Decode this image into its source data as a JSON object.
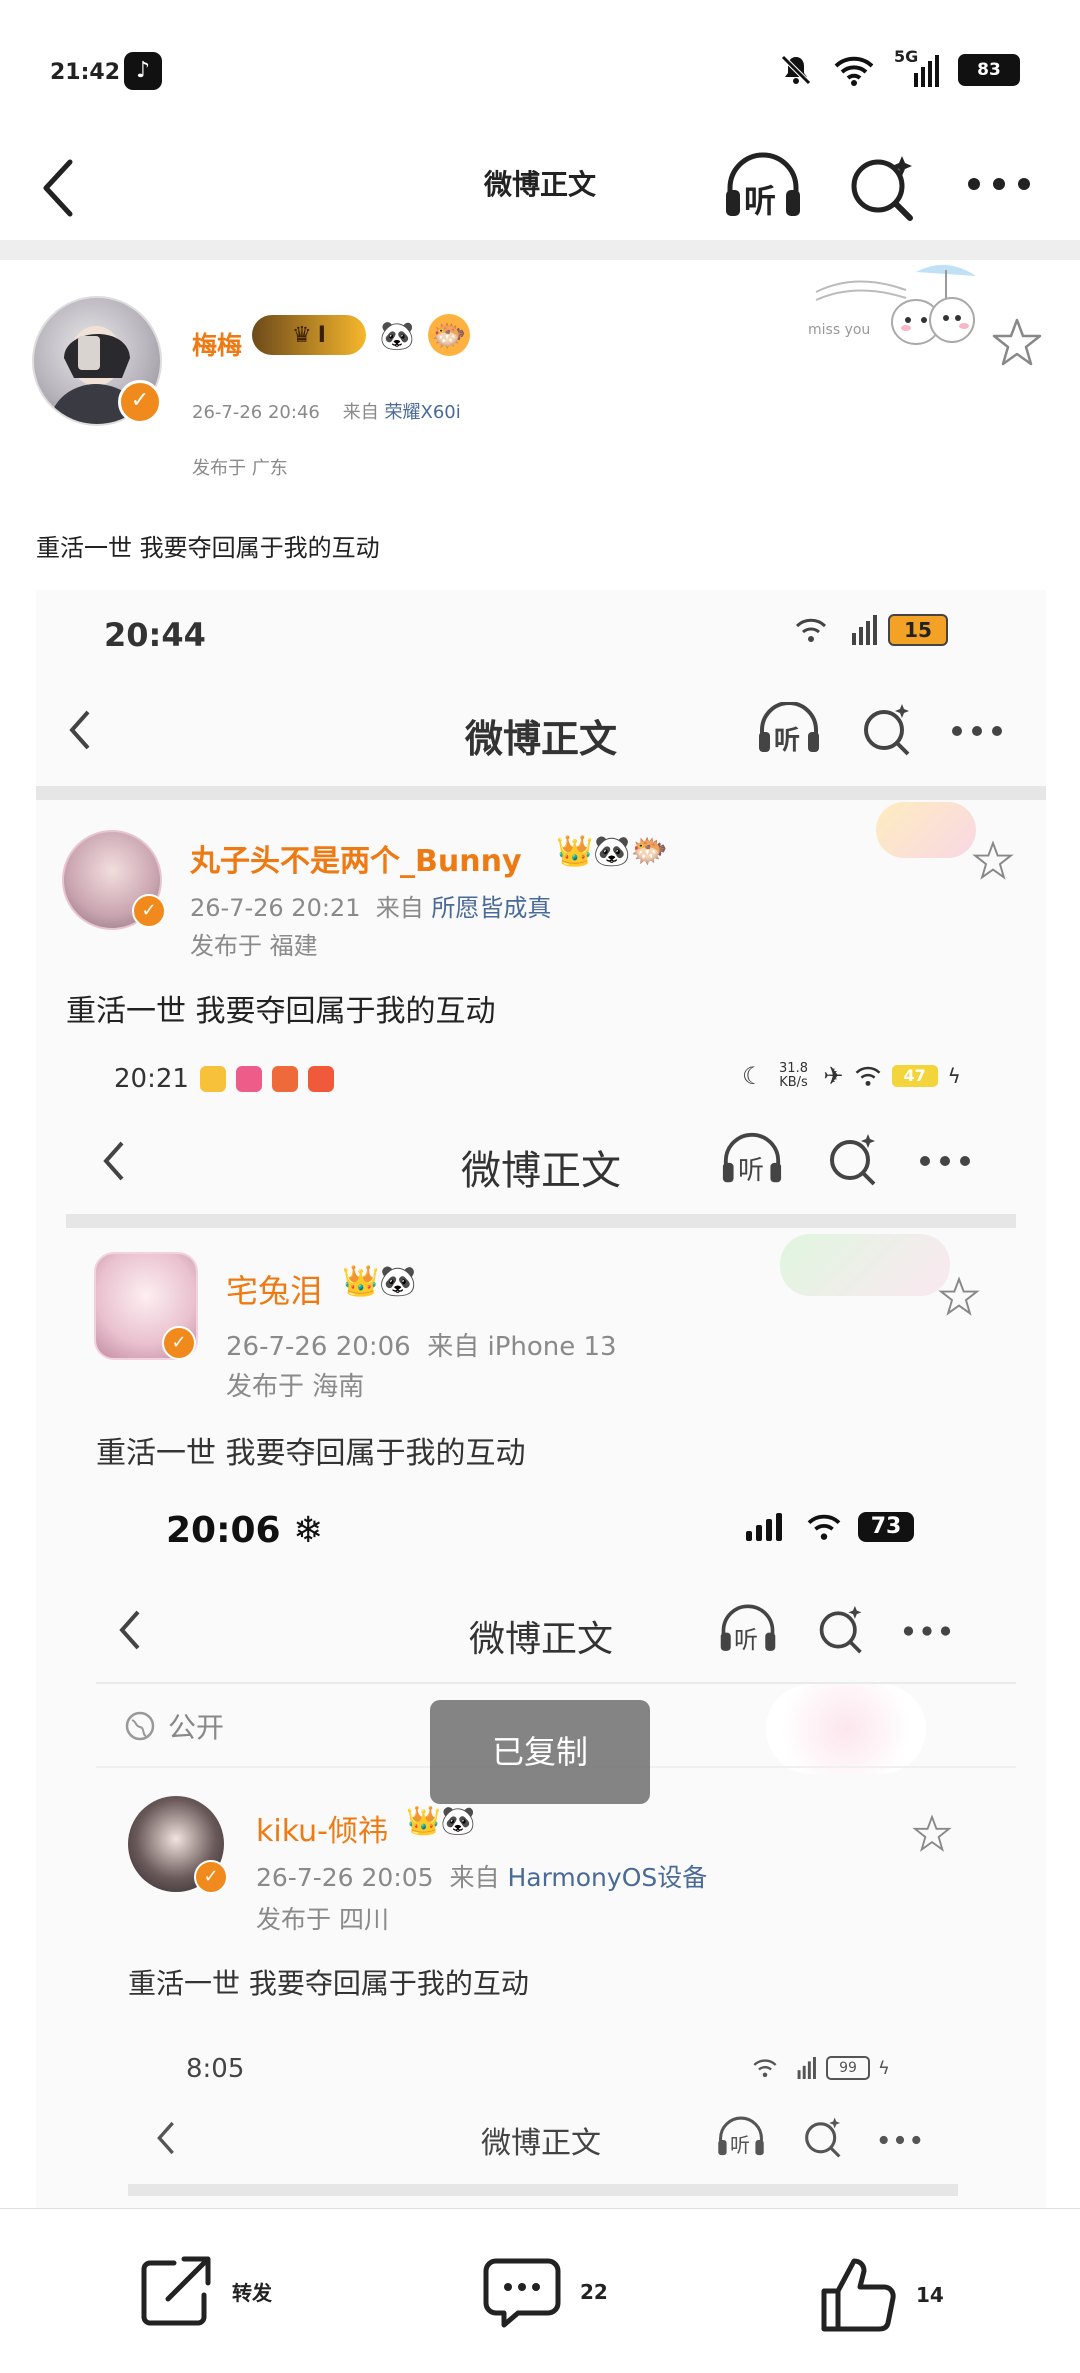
{
  "status_bar": {
    "time": "21:42",
    "network": "5G",
    "battery": "83"
  },
  "nav": {
    "title": "微博正文",
    "listen_label": "听"
  },
  "post": {
    "username": "梅梅",
    "badge_text": "I",
    "timestamp": "26-7-26 20:46",
    "from_prefix": "来自",
    "source": "荣耀X60i",
    "location": "发布于 广东",
    "deco_text": "miss you",
    "text": "重活一世 我要夺回属于我的互动"
  },
  "embed": {
    "level1": {
      "time": "20:44",
      "battery": "15",
      "nav_title": "微博正文",
      "listen_label": "听",
      "username": "丸子头不是两个_Bunny",
      "timestamp": "26-7-26 20:21",
      "from_prefix": "来自",
      "source": "所愿皆成真",
      "location": "发布于 福建",
      "text": "重活一世 我要夺回属于我的互动"
    },
    "level2": {
      "time": "20:21",
      "speed": "31.8 KB/s",
      "battery": "47",
      "nav_title": "微博正文",
      "listen_label": "听",
      "username": "宅兔泪",
      "timestamp": "26-7-26 20:06",
      "from_prefix": "来自",
      "source": "iPhone 13",
      "location": "发布于 海南",
      "text": "重活一世 我要夺回属于我的互动"
    },
    "level3": {
      "time": "20:06",
      "battery": "73",
      "nav_title": "微博正文",
      "listen_label": "听",
      "public_label": "公开",
      "username": "kiku-倾祎",
      "timestamp": "26-7-26 20:05",
      "from_prefix": "来自",
      "source": "HarmonyOS设备",
      "location": "发布于 四川",
      "text": "重活一世 我要夺回属于我的互动"
    },
    "level4": {
      "time": "8:05",
      "battery": "99",
      "nav_title": "微博正文",
      "listen_label": "听"
    }
  },
  "toast": {
    "text": "已复制"
  },
  "bottom_bar": {
    "repost_label": "转发",
    "comment_count": "22",
    "like_count": "14"
  },
  "colors": {
    "accent_orange": "#ee7a14",
    "source_blue": "#4a6a98",
    "gray_text": "#8a8a8a"
  }
}
